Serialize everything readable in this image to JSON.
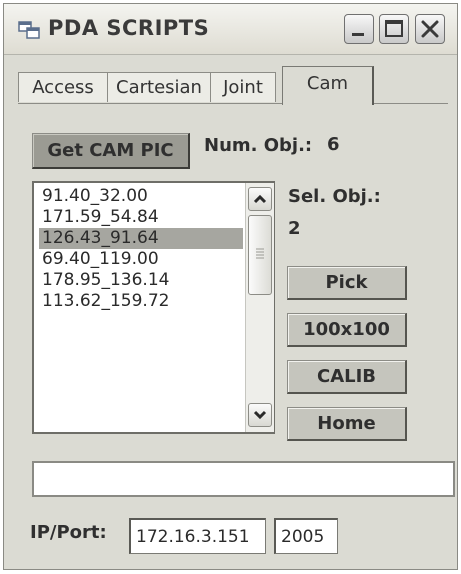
{
  "window": {
    "title": "PDA SCRIPTS"
  },
  "icons": {
    "app": "application-window-icon",
    "minimize": "minimize-icon",
    "maximize": "maximize-icon",
    "close": "close-icon",
    "scroll_up": "chevron-up-icon",
    "scroll_down": "chevron-down-icon"
  },
  "tabs": [
    {
      "label": "Access"
    },
    {
      "label": "Cartesian"
    },
    {
      "label": "Joint"
    },
    {
      "label": "Cam",
      "active": true
    }
  ],
  "cam": {
    "get_pic_label": "Get CAM PIC",
    "num_obj_label": "Num. Obj.:",
    "num_obj_value": "6",
    "sel_obj_label": "Sel. Obj.:",
    "sel_obj_value": "2",
    "objects": [
      "91.40_32.00",
      "171.59_54.84",
      "126.43_91.64",
      "69.40_119.00",
      "178.95_136.14",
      "113.62_159.72"
    ],
    "selected_index": 2,
    "buttons": {
      "pick": "Pick",
      "size": "100x100",
      "calib": "CALIB",
      "home": "Home"
    },
    "status_text": ""
  },
  "network": {
    "label": "IP/Port:",
    "ip": "172.16.3.151",
    "port": "2005"
  },
  "colors": {
    "window_bg": "#dbdbd3",
    "button_bg": "#c5c5bd",
    "selected_row": "#a6a6a0",
    "get_pic_button": "#9b9b93"
  }
}
